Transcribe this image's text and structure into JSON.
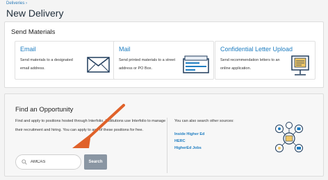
{
  "breadcrumb": "Deliveries  ›",
  "page_title": "New Delivery",
  "send_materials": {
    "heading": "Send Materials",
    "options": [
      {
        "title": "Email",
        "description": "Send materials to a designated email address.",
        "icon": "envelope-icon"
      },
      {
        "title": "Mail",
        "description": "Send printed materials to a street address or PO Box.",
        "icon": "mail-package-icon"
      },
      {
        "title": "Confidential Letter Upload",
        "description": "Send recommendation letters to an online application.",
        "icon": "monitor-upload-icon"
      }
    ]
  },
  "find_opportunity": {
    "heading": "Find an Opportunity",
    "description": "Find and apply to positions hosted through Interfolio. Institutions use Interfolio to manage their recruitment and hiring. You can apply to any of these positions for free.",
    "search_value": "AMCAS",
    "search_button": "Search",
    "also_search": "You can also search other sources:",
    "sources": [
      "Inside Higher Ed",
      "HERC",
      "HigherEd Jobs"
    ]
  },
  "colors": {
    "accent": "#1e7dc1",
    "arrow": "#e0622a",
    "search_button": "#8a96a3",
    "navy": "#1f3b5b"
  }
}
